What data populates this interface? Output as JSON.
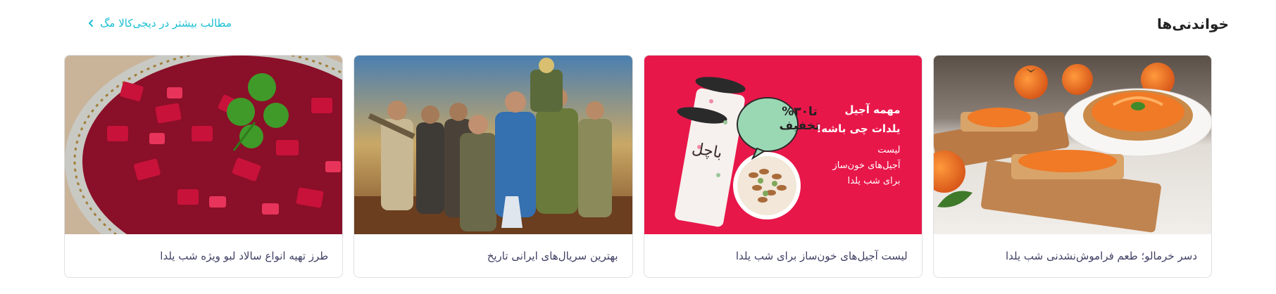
{
  "section": {
    "title": "خواندنی‌ها",
    "more_link": "مطالب بیشتر در دیجی‌کالا مگ"
  },
  "cards": [
    {
      "caption": "دسر خرمالو؛ طعم فراموش‌نشدنی شب یلدا",
      "image": "persimmon-dessert-photo"
    },
    {
      "caption": "لیست آجیل‌های خون‌ساز برای شب یلدا",
      "image": "nuts-promo-banner",
      "promo": {
        "headline_line1": "مهمه آجیل",
        "headline_line2": "یلدات چی باشه!",
        "sub_line1": "لیست",
        "sub_line2": "آجیل‌های خون‌ساز",
        "sub_line3": "برای شب یلدا",
        "badge_line1": "تا۳۰%",
        "badge_line2": "تخفیف",
        "brand": "باچل"
      }
    },
    {
      "caption": "بهترین سریال‌های ایرانی تاریخ",
      "image": "iranian-series-cast-photo"
    },
    {
      "caption": "طرز تهیه انواع سالاد لبو ویژه شب یلدا",
      "image": "beet-salad-photo"
    }
  ],
  "colors": {
    "link": "#19bfd3",
    "promo_bg": "#e8174a",
    "badge_bg": "#9ad8b4"
  }
}
